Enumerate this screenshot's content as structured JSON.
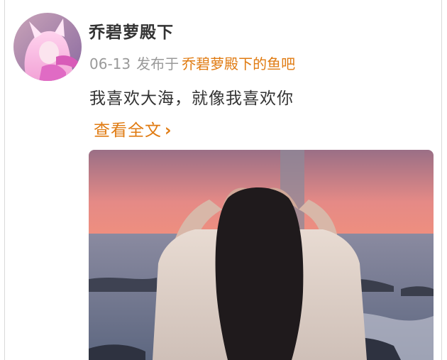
{
  "post": {
    "username": "乔碧萝殿下",
    "date": "06-13",
    "posted_in": "发布于",
    "forum": "乔碧萝殿下的鱼吧",
    "text": "我喜欢大海，就像我喜欢你",
    "read_more": "查看全文",
    "read_more_chevron": "›"
  },
  "icons": {
    "avatar": "avatar-image",
    "photo": "post-photo-sunset-heart"
  },
  "colors": {
    "link": "#e07b12",
    "meta": "#999999",
    "text": "#333333"
  }
}
